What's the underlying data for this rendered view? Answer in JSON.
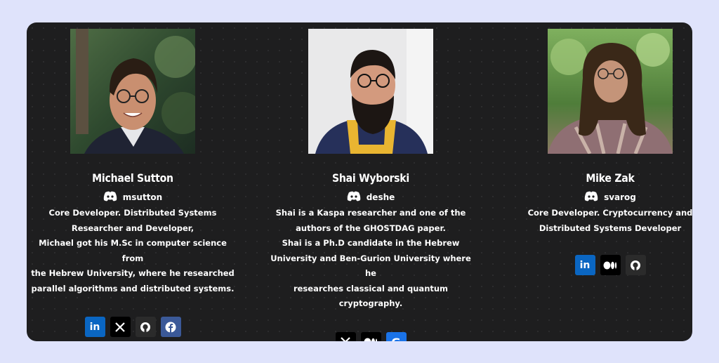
{
  "team": [
    {
      "name": "Michael Sutton",
      "handle": "msutton",
      "description": [
        "Core Developer. Distributed Systems",
        "Researcher and Developer,",
        "Michael got his M.Sc in computer science from",
        "the Hebrew University, where he researched",
        "parallel algorithms and distributed systems."
      ],
      "socials": [
        {
          "icon": "linkedin-icon",
          "glyph": "in",
          "color": "#0a66c2"
        },
        {
          "icon": "x-twitter-icon",
          "glyph": "X",
          "color": "#000000"
        },
        {
          "icon": "github-icon",
          "glyph": "",
          "color": "#2b2b2b"
        },
        {
          "icon": "facebook-icon",
          "glyph": "f",
          "color": "#3b5998"
        }
      ]
    },
    {
      "name": "Shai Wyborski",
      "handle": "deshe",
      "description": [
        "Shai is a Kaspa researcher and one of the",
        "authors of the GHOSTDAG paper.",
        "Shai is a Ph.D candidate in the Hebrew",
        "University and Ben-Gurion University where he",
        "researches classical and quantum",
        "cryptography."
      ],
      "socials": [
        {
          "icon": "x-twitter-icon",
          "glyph": "X",
          "color": "#000000"
        },
        {
          "icon": "medium-icon",
          "glyph": "",
          "color": "#000000"
        },
        {
          "icon": "google-scholar-icon",
          "glyph": "G",
          "color": "#1a73e8"
        }
      ]
    },
    {
      "name": "Mike Zak",
      "handle": "svarog",
      "description": [
        "Core Developer. Cryptocurrency and",
        "Distributed Systems Developer"
      ],
      "socials": [
        {
          "icon": "linkedin-icon",
          "glyph": "in",
          "color": "#0a66c2"
        },
        {
          "icon": "medium-icon",
          "glyph": "",
          "color": "#000000"
        },
        {
          "icon": "github-icon",
          "glyph": "",
          "color": "#2b2b2b"
        }
      ]
    }
  ],
  "handle_icon": "discord-icon",
  "colors": {
    "page_bg": "#dfe3fb",
    "panel_bg": "#1e1e1f",
    "text": "#ffffff"
  }
}
